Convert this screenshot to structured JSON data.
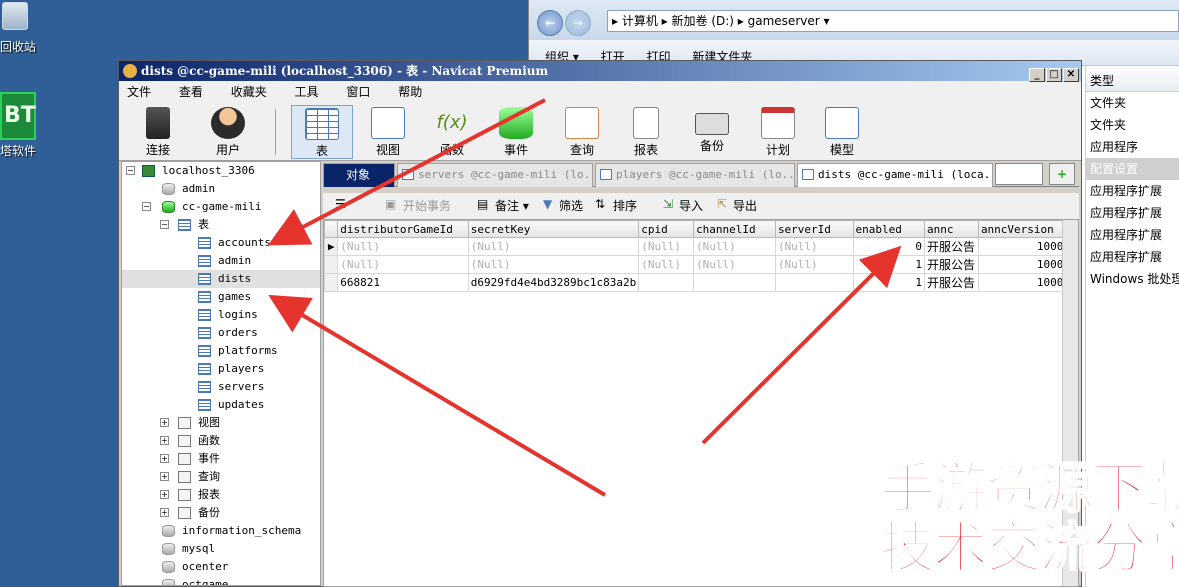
{
  "desktop": {
    "recycle_label": "回收站",
    "bt_badge": "BT",
    "bt_label": "塔软件"
  },
  "explorer": {
    "address": [
      "计算机",
      "新加卷 (D:)",
      "gameserver"
    ],
    "toolbar": [
      "组织 ▾",
      "打开",
      "打印",
      "新建文件夹"
    ],
    "type_header": "类型",
    "type_items": [
      "文件夹",
      "文件夹",
      "应用程序",
      "配置设置",
      "应用程序扩展",
      "应用程序扩展",
      "应用程序扩展",
      "应用程序扩展",
      "Windows 批处理..."
    ],
    "type_selected_index": 3
  },
  "window": {
    "title": "dists @cc-game-mili (localhost_3306) - 表 - Navicat Premium"
  },
  "menu": [
    "文件",
    "查看",
    "收藏夹",
    "工具",
    "窗口",
    "帮助"
  ],
  "toolbar": {
    "connect": "连接",
    "user": "用户",
    "table": "表",
    "view": "视图",
    "function": "函数",
    "event": "事件",
    "query": "查询",
    "report": "报表",
    "backup": "备份",
    "schedule": "计划",
    "model": "模型"
  },
  "tree": {
    "connection": "localhost_3306",
    "admin_db": "admin",
    "game_db": "cc-game-mili",
    "tables_label": "表",
    "tables": [
      "accounts",
      "admin",
      "dists",
      "games",
      "logins",
      "orders",
      "platforms",
      "players",
      "servers",
      "updates"
    ],
    "selected_table": "dists",
    "groups": [
      "视图",
      "函数",
      "事件",
      "查询",
      "报表",
      "备份"
    ],
    "other_dbs": [
      "information_schema",
      "mysql",
      "ocenter",
      "octgame"
    ]
  },
  "tabs": {
    "objects": "对象",
    "items": [
      "servers @cc-game-mili (lo...",
      "players @cc-game-mili (lo...",
      "dists @cc-game-mili (loca..."
    ],
    "active_index": 2
  },
  "subtoolbar": {
    "begin_txn": "开始事务",
    "memo": "备注",
    "filter": "筛选",
    "sort": "排序",
    "import": "导入",
    "export": "导出"
  },
  "grid": {
    "columns": [
      "distributorGameId",
      "secretKey",
      "cpid",
      "channelId",
      "serverId",
      "enabled",
      "annc",
      "anncVersion"
    ],
    "rows": [
      [
        "(Null)",
        "(Null)",
        "(Null)",
        "(Null)",
        "(Null)",
        "0",
        "开服公告",
        "10000"
      ],
      [
        "(Null)",
        "(Null)",
        "(Null)",
        "(Null)",
        "(Null)",
        "1",
        "开服公告",
        "10000"
      ],
      [
        "668821",
        "d6929fd4e4bd3289bc1c83a2b",
        "",
        "",
        "",
        "1",
        "开服公告",
        "10000"
      ]
    ]
  },
  "watermark": {
    "line1": "手游资源下载",
    "line2": "技术交流分享"
  },
  "colors": {
    "title_bar": "#0a246a",
    "arrow": "#e5342e",
    "watermark": "#e8222c",
    "desktop": "#2f5f96"
  }
}
